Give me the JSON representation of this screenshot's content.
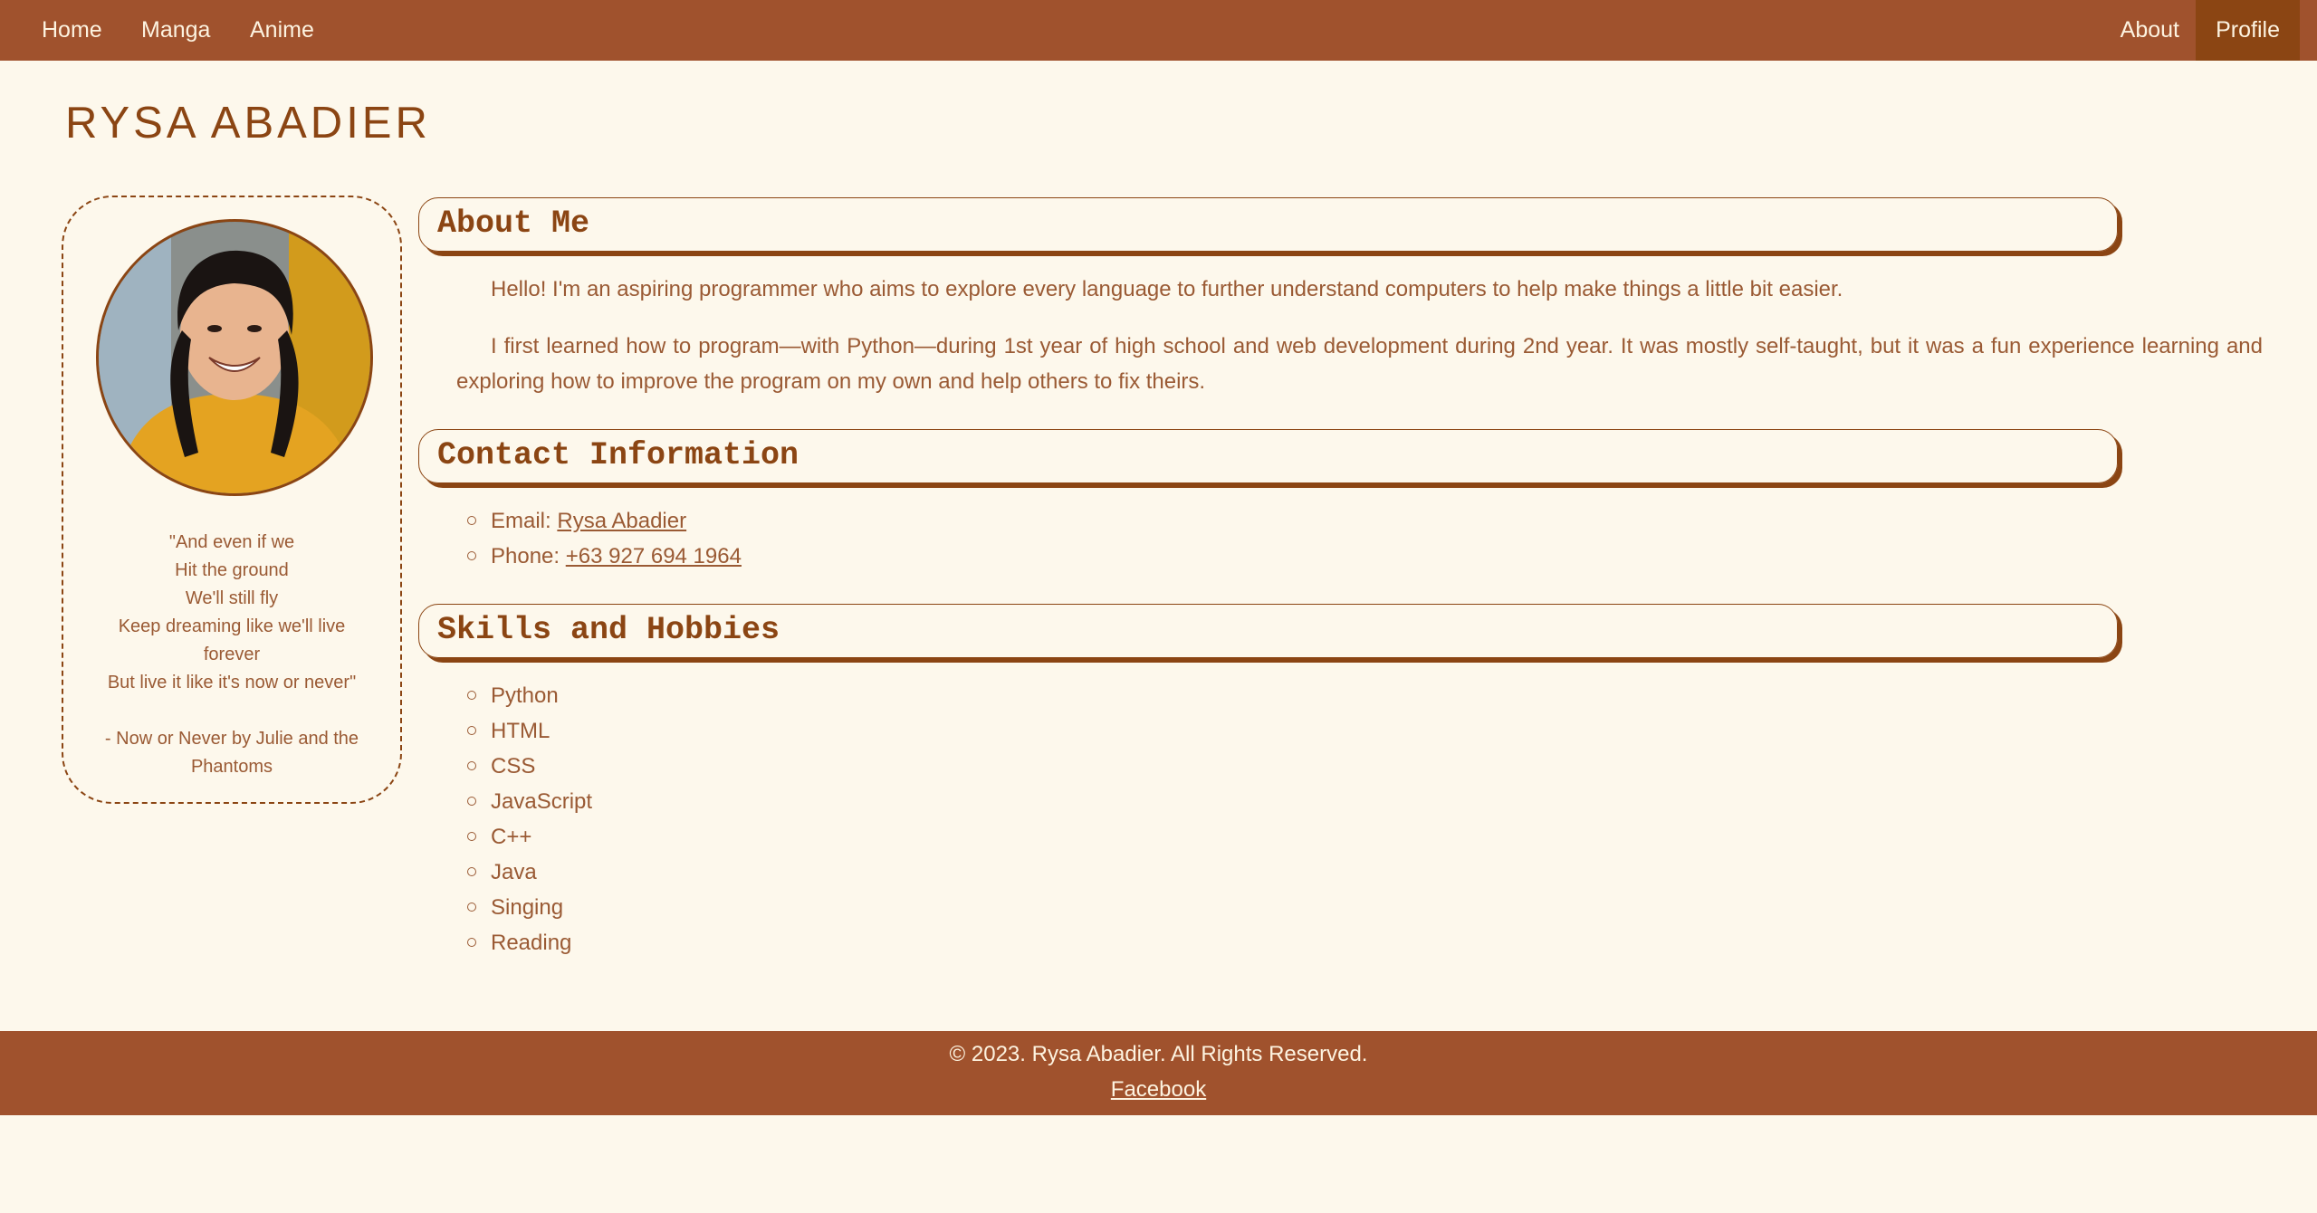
{
  "nav": {
    "left": [
      "Home",
      "Manga",
      "Anime"
    ],
    "right": [
      "About",
      "Profile"
    ],
    "active": "Profile"
  },
  "site_title": "RYSA ABADIER",
  "sidebar": {
    "avatar_alt": "profile-photo",
    "quote": "\"And even if we\nHit the ground\nWe'll still fly\nKeep dreaming like we'll live\nforever\nBut live it like it's now or never\"\n\n- Now or Never by Julie and the\nPhantoms"
  },
  "about": {
    "heading": "About Me",
    "p1": "Hello! I'm an aspiring programmer who aims to explore every language to further understand computers to help make things a little bit easier.",
    "p2": "I first learned how to program—with Python—during 1st year of high school and web development during 2nd year. It was mostly self-taught, but it was a fun experience learning and exploring how to improve the program on my own and help others to fix theirs."
  },
  "contact": {
    "heading": "Contact Information",
    "email_label": "Email:",
    "email_value": "Rysa Abadier",
    "phone_label": "Phone:",
    "phone_value": "+63 927 694 1964"
  },
  "skills": {
    "heading": "Skills and Hobbies",
    "items": [
      "Python",
      "HTML",
      "CSS",
      "JavaScript",
      "C++",
      "Java",
      "Singing",
      "Reading"
    ]
  },
  "footer": {
    "copyright": "© 2023. Rysa Abadier. All Rights Reserved.",
    "facebook": "Facebook"
  },
  "colors": {
    "nav_bg": "#a0522d",
    "active_bg": "#8b4513",
    "page_bg": "#fdf8ec",
    "accent": "#8b4513",
    "text": "#9a5a34"
  }
}
